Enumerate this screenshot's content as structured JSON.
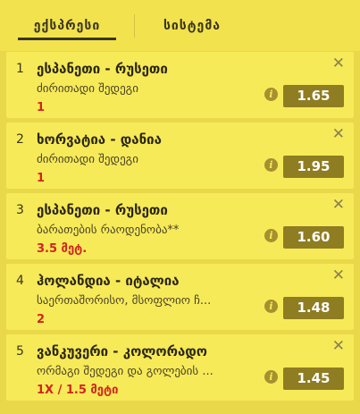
{
  "tabs": [
    {
      "label": "ექსპრესი",
      "active": true
    },
    {
      "label": "სისტემა",
      "active": false
    }
  ],
  "bets": [
    {
      "num": "1",
      "match": "ესპანეთი - რუსეთი",
      "market": "ძირითადი შედეგი",
      "selection": "1",
      "odds": "1.65"
    },
    {
      "num": "2",
      "match": "ხორვატია - დანია",
      "market": "ძირითადი შედეგი",
      "selection": "1",
      "odds": "1.95"
    },
    {
      "num": "3",
      "match": "ესპანეთი - რუსეთი",
      "market": "ბარათების რაოდენობა**",
      "selection": "3.5 მეტ.",
      "odds": "1.60"
    },
    {
      "num": "4",
      "match": "ჰოლანდია - იტალია",
      "market": "საერთაშორისო, მსოფლიო ჩ...",
      "selection": "2",
      "odds": "1.48"
    },
    {
      "num": "5",
      "match": "ვანკუვერი - კოლორადო",
      "market": "ორმაგი შედეგი და გოლების ...",
      "selection": "1X / 1.5 მეტი",
      "odds": "1.45"
    }
  ],
  "icons": {
    "close": "close-icon",
    "info": "info-icon"
  },
  "colors": {
    "background": "#e8d84a",
    "card": "#f7ea58",
    "odds_button": "#8f7d22",
    "selection": "#d2241e"
  }
}
